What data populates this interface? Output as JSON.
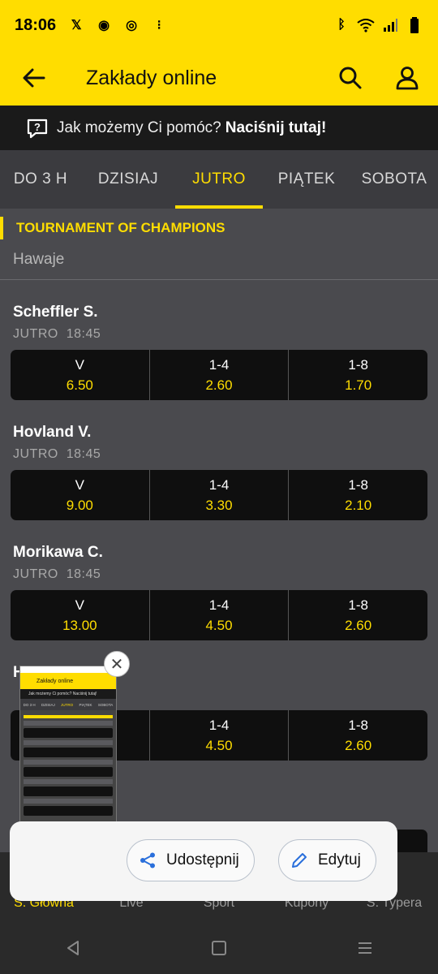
{
  "status": {
    "time": "18:06"
  },
  "app_bar": {
    "title": "Zakłady online"
  },
  "help": {
    "text": "Jak możemy Ci pomóc?",
    "strong": "Naciśnij tutaj!"
  },
  "tabs": [
    "DO 3 H",
    "DZISIAJ",
    "JUTRO",
    "PIĄTEK",
    "SOBOTA"
  ],
  "tournament": {
    "name": "TOURNAMENT OF CHAMPIONS",
    "location": "Hawaje"
  },
  "players": [
    {
      "name": "Scheffler S.",
      "day": "JUTRO",
      "time": "18:45",
      "odds": [
        {
          "label": "V",
          "value": "6.50"
        },
        {
          "label": "1-4",
          "value": "2.60"
        },
        {
          "label": "1-8",
          "value": "1.70"
        }
      ]
    },
    {
      "name": "Hovland V.",
      "day": "JUTRO",
      "time": "18:45",
      "odds": [
        {
          "label": "V",
          "value": "9.00"
        },
        {
          "label": "1-4",
          "value": "3.30"
        },
        {
          "label": "1-8",
          "value": "2.10"
        }
      ]
    },
    {
      "name": "Morikawa C.",
      "day": "JUTRO",
      "time": "18:45",
      "odds": [
        {
          "label": "V",
          "value": "13.00"
        },
        {
          "label": "1-4",
          "value": "4.50"
        },
        {
          "label": "1-8",
          "value": "2.60"
        }
      ]
    },
    {
      "name": "H",
      "day": "",
      "time": "",
      "odds": [
        {
          "label": "",
          "value": ""
        },
        {
          "label": "1-4",
          "value": "4.50"
        },
        {
          "label": "1-8",
          "value": "2.60"
        }
      ]
    }
  ],
  "bottom_nav": [
    "S. Główna",
    "Live",
    "Sport",
    "Kupony",
    "S. Typera"
  ],
  "share": {
    "share_label": "Udostępnij",
    "edit_label": "Edytuj"
  },
  "thumbnail": {
    "title": "Zakłady online",
    "help": "Jak możemy Ci pomóc? Naciśnij tutaj!",
    "tabs": [
      "DO 3 H",
      "DZISIAJ",
      "JUTRO",
      "PIĄTEK",
      "SOBOTA"
    ]
  },
  "colors": {
    "accent": "#ffdd00",
    "background": "#4a4a4e",
    "odds_bg": "#0f0f0f"
  }
}
